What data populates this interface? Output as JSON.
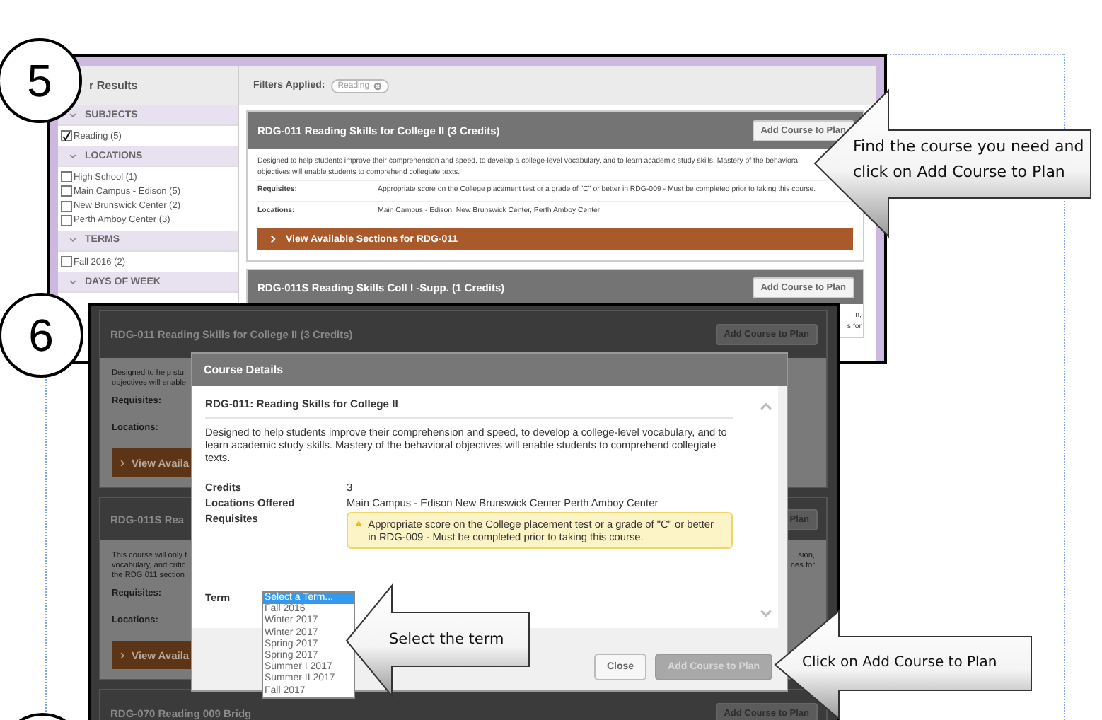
{
  "step_5": {
    "number": "5",
    "sidebar": {
      "title": "r Results",
      "sections": [
        {
          "heading": "SUBJECTS",
          "options": [
            {
              "label": "Reading (5)",
              "checked": true
            }
          ]
        },
        {
          "heading": "LOCATIONS",
          "options": [
            {
              "label": "High School (1)",
              "checked": false
            },
            {
              "label": "Main Campus - Edison (5)",
              "checked": false
            },
            {
              "label": "New Brunswick Center (2)",
              "checked": false
            },
            {
              "label": "Perth Amboy Center (3)",
              "checked": false
            }
          ]
        },
        {
          "heading": "TERMS",
          "options": [
            {
              "label": "Fall 2016 (2)",
              "checked": false
            }
          ]
        },
        {
          "heading": "DAYS OF WEEK"
        }
      ]
    },
    "filters": {
      "label": "Filters Applied:",
      "chips": [
        {
          "label": "Reading"
        }
      ]
    },
    "courses": [
      {
        "title": "RDG-011 Reading Skills for College II (3 Credits)",
        "button": "Add Course to Plan",
        "description": [
          "Designed to help students improve their comprehension and speed, to develop a college-level vocabulary, and to learn academic study skills. Mastery of the behaviora",
          "objectives will enable students to comprehend collegiate texts."
        ],
        "requisites_label": "Requisites:",
        "requisites": "Appropriate score on the College placement test or a grade of \"C\" or better in RDG-009 - Must be completed prior to taking this course.",
        "locations_label": "Locations:",
        "locations": "Main Campus - Edison, New Brunswick Center, Perth Amboy Center",
        "sections_button": "View Available Sections for RDG-011"
      },
      {
        "title": "RDG-011S Reading Skills Coll I -Supp. (1 Credits)",
        "button": "Add Course to Plan",
        "description": [
          "n,",
          "s for"
        ]
      }
    ],
    "callout": "Find the course you need and click on Add Course to Plan"
  },
  "step_6": {
    "number": "6",
    "courses": [
      {
        "title": "RDG-011 Reading Skills for College II (3 Credits)",
        "button": "Add Course to Plan",
        "description": [
          "Designed to help stu",
          "objectives will enable"
        ],
        "requisites_label": "Requisites:",
        "locations_label": "Locations:",
        "sections_button": "View Availa"
      },
      {
        "title": "RDG-011S Rea",
        "button": "Plan",
        "description": [
          "This course will only t",
          "vocabulary, and critic",
          "the RDG 011 section"
        ],
        "edge_text": [
          "sion,",
          "nes for"
        ],
        "requisites_label": "Requisites:",
        "locations_label": "Locations:",
        "sections_button": "View Availa"
      },
      {
        "title": "RDG-070 Reading 009 Bridg",
        "button": "Add Course to Plan"
      }
    ],
    "modal": {
      "title": "Course Details",
      "heading": "RDG-011: Reading Skills for College II",
      "description": "Designed to help students improve their comprehension and speed, to develop a college-level vocabulary, and to learn academic study skills. Mastery of the behavioral objectives will enable students to comprehend collegiate texts.",
      "details": [
        {
          "kind": "text",
          "label": "Credits",
          "value": "3"
        },
        {
          "kind": "text",
          "label": "Locations Offered",
          "value": "Main Campus - Edison New Brunswick Center Perth Amboy Center"
        },
        {
          "kind": "warning",
          "label": "Requisites",
          "value": "Appropriate score on the College placement test or a grade of \"C\" or better in RDG-009 - Must be completed prior to taking this course."
        }
      ],
      "term": {
        "label": "Term",
        "options": [
          {
            "label": "Select a Term...",
            "selected": true
          },
          {
            "label": "Fall 2016",
            "selected": false
          },
          {
            "label": "Winter 2017",
            "selected": false
          },
          {
            "label": "Winter 2017",
            "selected": false
          },
          {
            "label": "Spring 2017",
            "selected": false
          },
          {
            "label": "Spring 2017",
            "selected": false
          },
          {
            "label": "Summer I 2017",
            "selected": false
          },
          {
            "label": "Summer II 2017",
            "selected": false
          },
          {
            "label": "Fall 2017",
            "selected": false
          }
        ]
      },
      "buttons": [
        {
          "label": "Close",
          "disabled": false
        },
        {
          "label": "Add Course to Plan",
          "disabled": true
        }
      ]
    },
    "callouts": [
      "Select the term",
      "Click on Add Course to Plan"
    ]
  }
}
